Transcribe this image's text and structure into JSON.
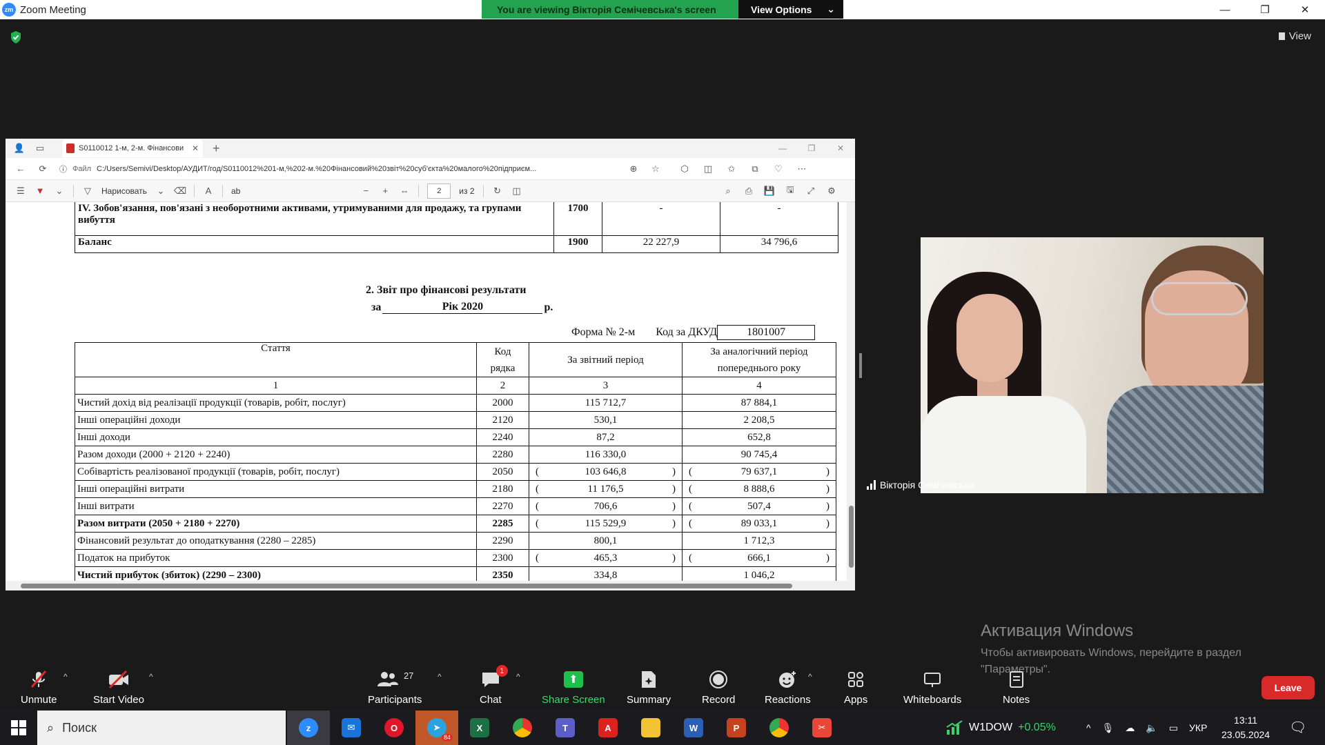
{
  "zoom": {
    "window_title": "Zoom Meeting",
    "logo_text": "zm",
    "viewing_banner": "You are viewing Вікторія Семічевська's screen",
    "view_options": "View Options",
    "view_button": "View"
  },
  "browser": {
    "tab_title": "S0110012 1-м, 2-м. Фінансови",
    "address_prefix": "Файл",
    "address": "C:/Users/Semivi/Desktop/АУДИТ/год/S0110012%201-м,%202-м.%20Фінансовий%20звіт%20суб'єкта%20малого%20підприєм...",
    "draw_label": "Нарисовать",
    "read_aloud_icon": "аb",
    "page_current": "2",
    "page_total": "из 2"
  },
  "balance_rows": [
    {
      "name": "IV. Зобов'язання, пов'язані з необоротними активами, утримуваними для продажу, та групами вибуття",
      "code": "1700",
      "current": "-",
      "previous": "-"
    },
    {
      "name": "Баланс",
      "code": "1900",
      "current": "22 227,9",
      "previous": "34 796,6"
    }
  ],
  "report": {
    "title": "2. Звіт про фінансові результати",
    "period_prefix": "за",
    "period": "Рік 2020",
    "period_suffix": "р.",
    "form_label": "Форма № 2-м",
    "dkud_label": "Код за ДКУД",
    "dkud_code": "1801007",
    "headers": {
      "article": "Стаття",
      "code": "Код рядка",
      "current": "За звітний період",
      "previous": "За аналогічний період попереднього року"
    },
    "col_numbers": [
      "1",
      "2",
      "3",
      "4"
    ],
    "rows": [
      {
        "name": "Чистий дохід від реалізації продукції (товарів, робіт, послуг)",
        "code": "2000",
        "current": "115 712,7",
        "previous": "87 884,1",
        "paren": false,
        "bold": false
      },
      {
        "name": "Інші операційні доходи",
        "code": "2120",
        "current": "530,1",
        "previous": "2 208,5",
        "paren": false,
        "bold": false
      },
      {
        "name": "Інші доходи",
        "code": "2240",
        "current": "87,2",
        "previous": "652,8",
        "paren": false,
        "bold": false
      },
      {
        "name": "Разом доходи (2000 + 2120 + 2240)",
        "code": "2280",
        "current": "116 330,0",
        "previous": "90 745,4",
        "paren": false,
        "bold": false
      },
      {
        "name": "Собівартість реалізованої продукції (товарів, робіт, послуг)",
        "code": "2050",
        "current": "103 646,8",
        "previous": "79 637,1",
        "paren": true,
        "bold": false
      },
      {
        "name": "Інші операційні витрати",
        "code": "2180",
        "current": "11 176,5",
        "previous": "8 888,6",
        "paren": true,
        "bold": false
      },
      {
        "name": "Інші витрати",
        "code": "2270",
        "current": "706,6",
        "previous": "507,4",
        "paren": true,
        "bold": false
      },
      {
        "name": "Разом витрати (2050 + 2180 + 2270)",
        "code": "2285",
        "current": "115 529,9",
        "previous": "89 033,1",
        "paren": true,
        "bold": true
      },
      {
        "name": "Фінансовий результат до оподаткування (2280 – 2285)",
        "code": "2290",
        "current": "800,1",
        "previous": "1 712,3",
        "paren": false,
        "bold": false
      },
      {
        "name": "Податок на прибуток",
        "code": "2300",
        "current": "465,3",
        "previous": "666,1",
        "paren": true,
        "bold": false
      },
      {
        "name": "Чистий прибуток (збиток) (2290 – 2300)",
        "code": "2350",
        "current": "334,8",
        "previous": "1 046,2",
        "paren": false,
        "bold": true
      }
    ]
  },
  "participant": {
    "name": "Вікторія Семічевська"
  },
  "activation": {
    "title": "Активация Windows",
    "text_line1": "Чтобы активировать Windows, перейдите в раздел",
    "text_line2": "\"Параметры\"."
  },
  "controls": {
    "unmute": "Unmute",
    "start_video": "Start Video",
    "participants": "Participants",
    "participants_count": "27",
    "chat": "Chat",
    "chat_badge": "1",
    "share_screen": "Share Screen",
    "summary": "Summary",
    "record": "Record",
    "reactions": "Reactions",
    "apps": "Apps",
    "whiteboards": "Whiteboards",
    "notes": "Notes",
    "leave": "Leave"
  },
  "taskbar": {
    "search_placeholder": "Поиск",
    "telegram_badge": "84",
    "stock_name": "W1DOW",
    "stock_change": "+0.05%",
    "language": "УКР",
    "time": "13:11",
    "date": "23.05.2024"
  },
  "colors": {
    "zoom_green": "#23a34f",
    "leave_red": "#d92a2a",
    "stock_green": "#3fcf6b"
  }
}
